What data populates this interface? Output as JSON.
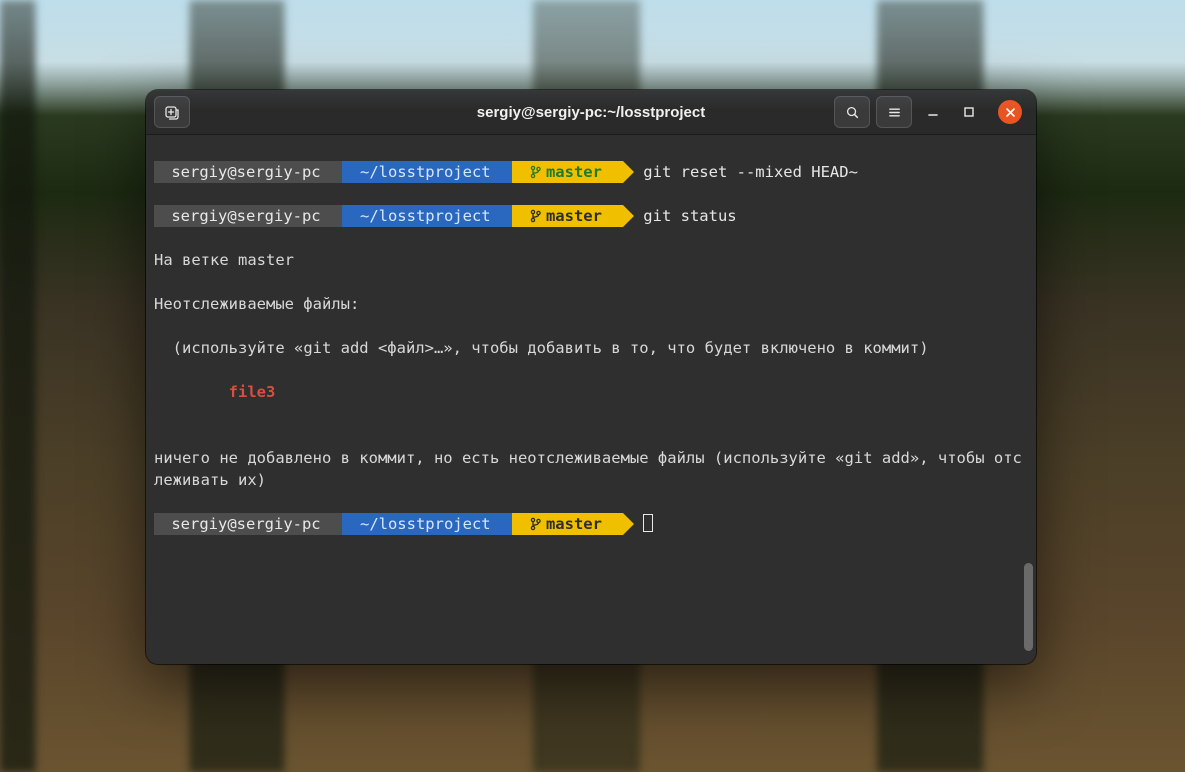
{
  "window": {
    "title": "sergiy@sergiy-pc:~/losstproject"
  },
  "prompt": {
    "userhost": " sergiy@sergiy-pc ",
    "path": "~/losstproject ",
    "branch": "master "
  },
  "lines": {
    "cmd1": "git reset --mixed HEAD~",
    "cmd2": "git status",
    "out1": "На ветке master",
    "out2": "Неотслеживаемые файлы:",
    "out3": "  (используйте «git add <файл>…», чтобы добавить в то, что будет включено в коммит)",
    "file": "        file3",
    "blank": "",
    "out4": "ничего не добавлено в коммит, но есть неотслеживаемые файлы (используйте «git add», чтобы отслеживать их)"
  },
  "colors": {
    "host_bg": "#4d4d4d",
    "path_bg": "#2a68c0",
    "branch_bg": "#f0c000",
    "branch_green": "#1f7a2e",
    "branch_dark": "#2d2d2d",
    "close": "#e95420"
  }
}
